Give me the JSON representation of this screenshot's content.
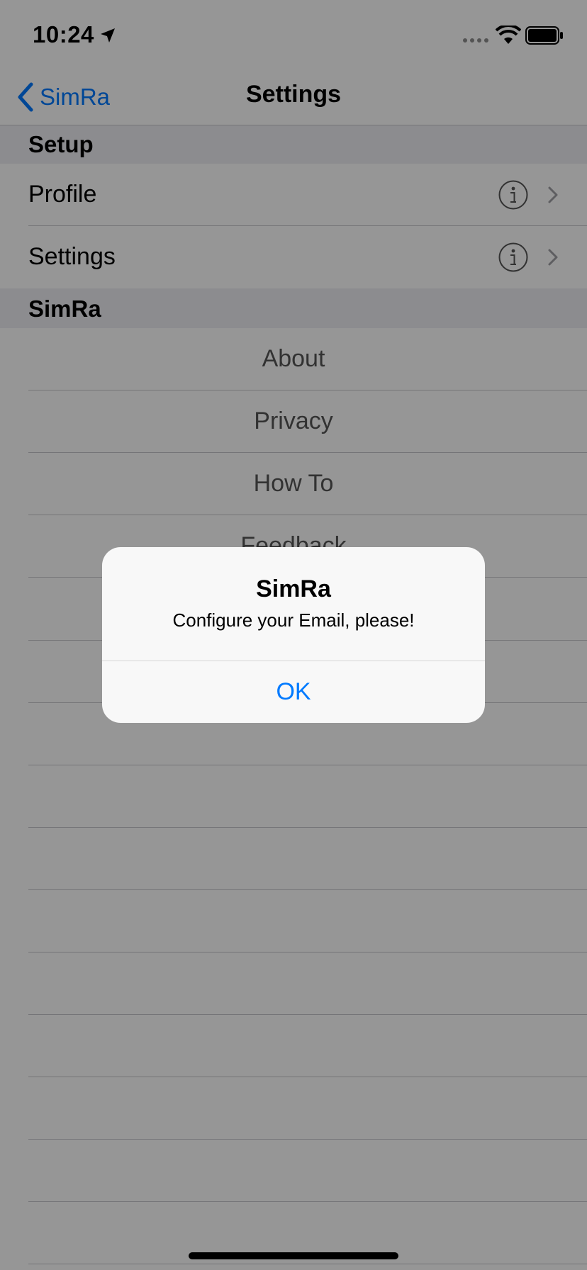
{
  "status_bar": {
    "time": "10:24"
  },
  "nav": {
    "back_label": "SimRa",
    "title": "Settings"
  },
  "sections": [
    {
      "header": "Setup",
      "rows": [
        "Profile",
        "Settings"
      ]
    },
    {
      "header": "SimRa",
      "rows": [
        "About",
        "Privacy",
        "How To",
        "Feedback"
      ]
    }
  ],
  "alert": {
    "title": "SimRa",
    "message": "Configure your Email, please!",
    "button": "OK"
  },
  "colors": {
    "accent": "#007aff",
    "dim_overlay": "rgba(0,0,0,0.41)"
  }
}
